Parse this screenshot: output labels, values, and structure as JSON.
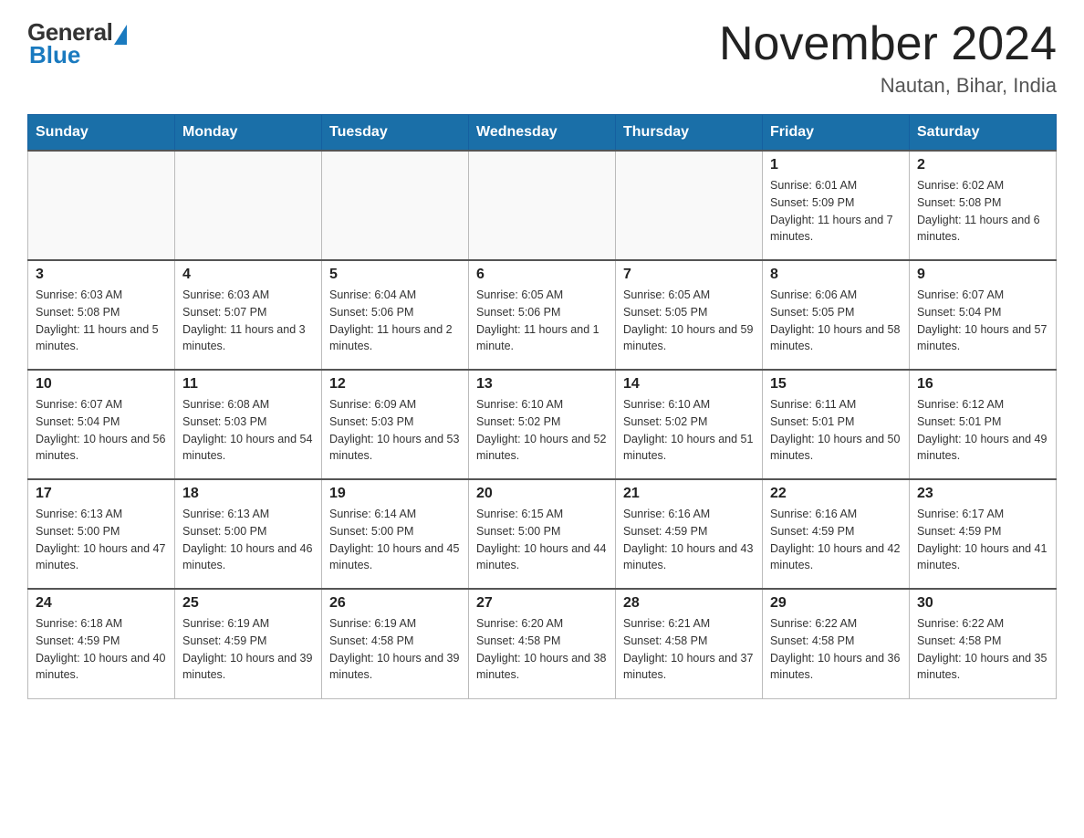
{
  "logo": {
    "general": "General",
    "blue": "Blue"
  },
  "header": {
    "title": "November 2024",
    "subtitle": "Nautan, Bihar, India"
  },
  "days_of_week": [
    "Sunday",
    "Monday",
    "Tuesday",
    "Wednesday",
    "Thursday",
    "Friday",
    "Saturday"
  ],
  "weeks": [
    [
      {
        "day": "",
        "info": ""
      },
      {
        "day": "",
        "info": ""
      },
      {
        "day": "",
        "info": ""
      },
      {
        "day": "",
        "info": ""
      },
      {
        "day": "",
        "info": ""
      },
      {
        "day": "1",
        "info": "Sunrise: 6:01 AM\nSunset: 5:09 PM\nDaylight: 11 hours and 7 minutes."
      },
      {
        "day": "2",
        "info": "Sunrise: 6:02 AM\nSunset: 5:08 PM\nDaylight: 11 hours and 6 minutes."
      }
    ],
    [
      {
        "day": "3",
        "info": "Sunrise: 6:03 AM\nSunset: 5:08 PM\nDaylight: 11 hours and 5 minutes."
      },
      {
        "day": "4",
        "info": "Sunrise: 6:03 AM\nSunset: 5:07 PM\nDaylight: 11 hours and 3 minutes."
      },
      {
        "day": "5",
        "info": "Sunrise: 6:04 AM\nSunset: 5:06 PM\nDaylight: 11 hours and 2 minutes."
      },
      {
        "day": "6",
        "info": "Sunrise: 6:05 AM\nSunset: 5:06 PM\nDaylight: 11 hours and 1 minute."
      },
      {
        "day": "7",
        "info": "Sunrise: 6:05 AM\nSunset: 5:05 PM\nDaylight: 10 hours and 59 minutes."
      },
      {
        "day": "8",
        "info": "Sunrise: 6:06 AM\nSunset: 5:05 PM\nDaylight: 10 hours and 58 minutes."
      },
      {
        "day": "9",
        "info": "Sunrise: 6:07 AM\nSunset: 5:04 PM\nDaylight: 10 hours and 57 minutes."
      }
    ],
    [
      {
        "day": "10",
        "info": "Sunrise: 6:07 AM\nSunset: 5:04 PM\nDaylight: 10 hours and 56 minutes."
      },
      {
        "day": "11",
        "info": "Sunrise: 6:08 AM\nSunset: 5:03 PM\nDaylight: 10 hours and 54 minutes."
      },
      {
        "day": "12",
        "info": "Sunrise: 6:09 AM\nSunset: 5:03 PM\nDaylight: 10 hours and 53 minutes."
      },
      {
        "day": "13",
        "info": "Sunrise: 6:10 AM\nSunset: 5:02 PM\nDaylight: 10 hours and 52 minutes."
      },
      {
        "day": "14",
        "info": "Sunrise: 6:10 AM\nSunset: 5:02 PM\nDaylight: 10 hours and 51 minutes."
      },
      {
        "day": "15",
        "info": "Sunrise: 6:11 AM\nSunset: 5:01 PM\nDaylight: 10 hours and 50 minutes."
      },
      {
        "day": "16",
        "info": "Sunrise: 6:12 AM\nSunset: 5:01 PM\nDaylight: 10 hours and 49 minutes."
      }
    ],
    [
      {
        "day": "17",
        "info": "Sunrise: 6:13 AM\nSunset: 5:00 PM\nDaylight: 10 hours and 47 minutes."
      },
      {
        "day": "18",
        "info": "Sunrise: 6:13 AM\nSunset: 5:00 PM\nDaylight: 10 hours and 46 minutes."
      },
      {
        "day": "19",
        "info": "Sunrise: 6:14 AM\nSunset: 5:00 PM\nDaylight: 10 hours and 45 minutes."
      },
      {
        "day": "20",
        "info": "Sunrise: 6:15 AM\nSunset: 5:00 PM\nDaylight: 10 hours and 44 minutes."
      },
      {
        "day": "21",
        "info": "Sunrise: 6:16 AM\nSunset: 4:59 PM\nDaylight: 10 hours and 43 minutes."
      },
      {
        "day": "22",
        "info": "Sunrise: 6:16 AM\nSunset: 4:59 PM\nDaylight: 10 hours and 42 minutes."
      },
      {
        "day": "23",
        "info": "Sunrise: 6:17 AM\nSunset: 4:59 PM\nDaylight: 10 hours and 41 minutes."
      }
    ],
    [
      {
        "day": "24",
        "info": "Sunrise: 6:18 AM\nSunset: 4:59 PM\nDaylight: 10 hours and 40 minutes."
      },
      {
        "day": "25",
        "info": "Sunrise: 6:19 AM\nSunset: 4:59 PM\nDaylight: 10 hours and 39 minutes."
      },
      {
        "day": "26",
        "info": "Sunrise: 6:19 AM\nSunset: 4:58 PM\nDaylight: 10 hours and 39 minutes."
      },
      {
        "day": "27",
        "info": "Sunrise: 6:20 AM\nSunset: 4:58 PM\nDaylight: 10 hours and 38 minutes."
      },
      {
        "day": "28",
        "info": "Sunrise: 6:21 AM\nSunset: 4:58 PM\nDaylight: 10 hours and 37 minutes."
      },
      {
        "day": "29",
        "info": "Sunrise: 6:22 AM\nSunset: 4:58 PM\nDaylight: 10 hours and 36 minutes."
      },
      {
        "day": "30",
        "info": "Sunrise: 6:22 AM\nSunset: 4:58 PM\nDaylight: 10 hours and 35 minutes."
      }
    ]
  ]
}
